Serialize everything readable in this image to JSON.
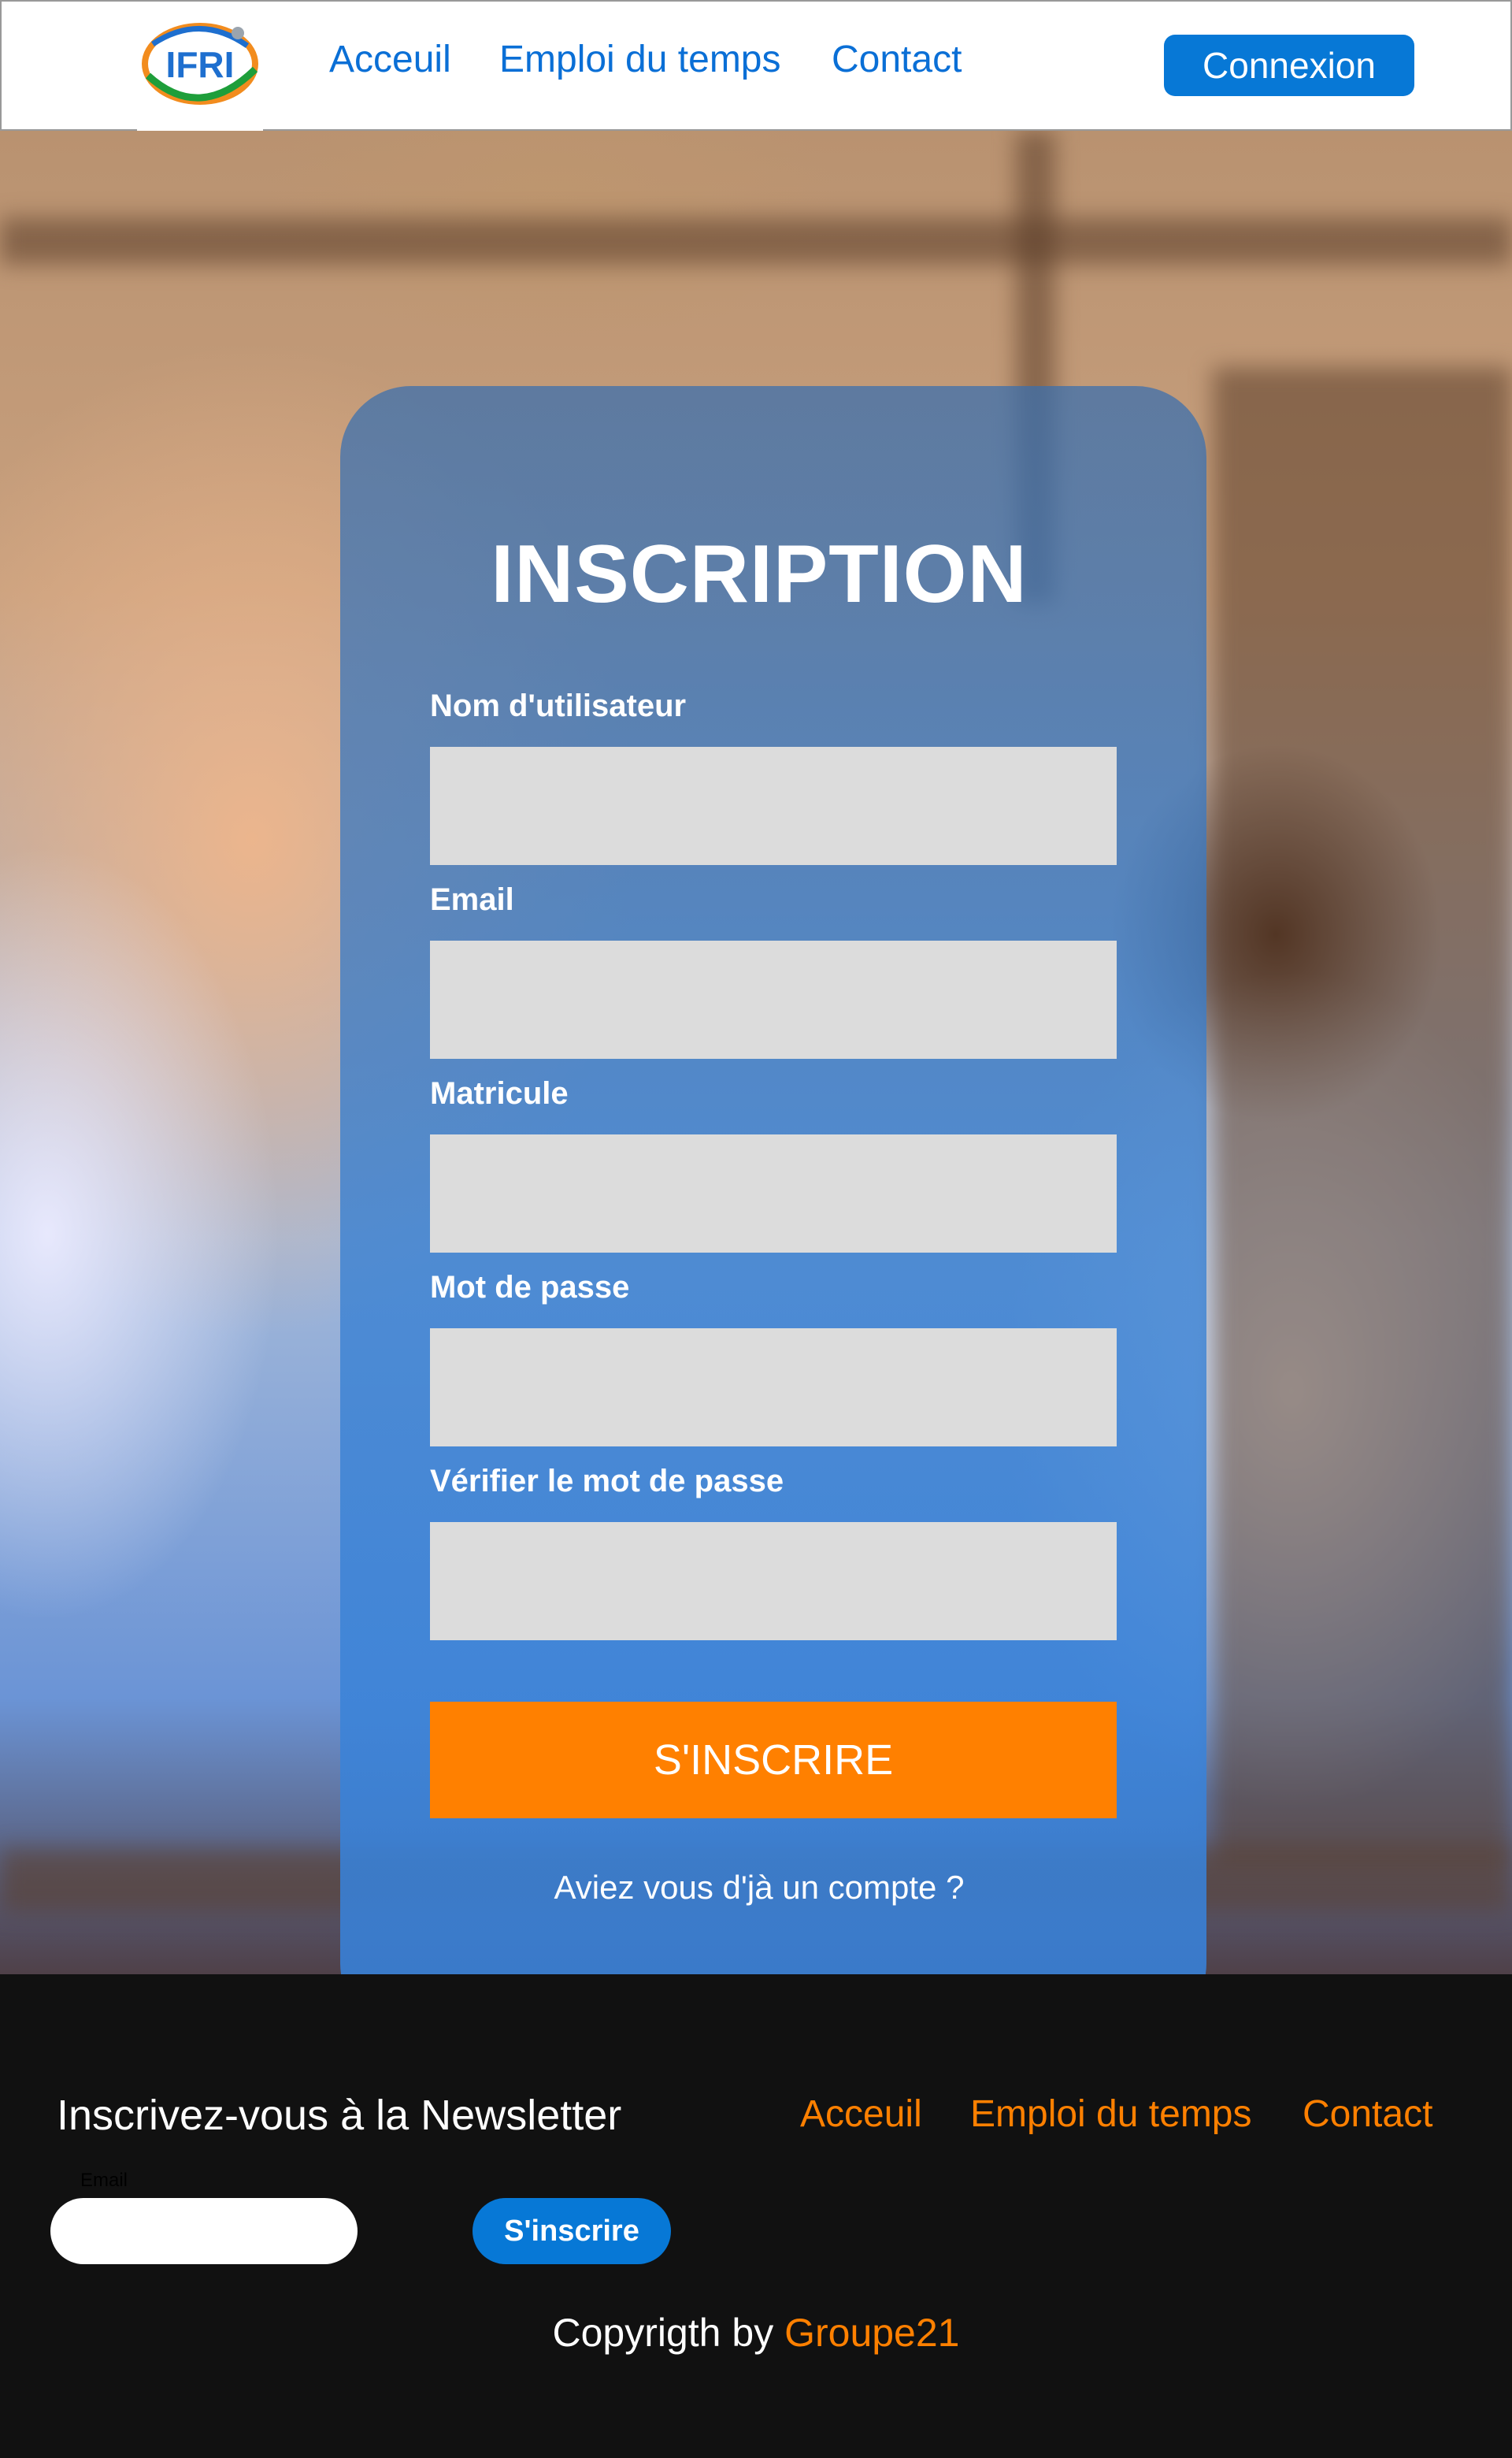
{
  "header": {
    "logo_text": "IFRI",
    "nav": [
      "Acceuil",
      "Emploi du temps",
      "Contact"
    ],
    "login_button": "Connexion"
  },
  "form": {
    "title": "INSCRIPTION",
    "fields": [
      {
        "label": "Nom d'utilisateur",
        "value": ""
      },
      {
        "label": "Email",
        "value": ""
      },
      {
        "label": "Matricule",
        "value": ""
      },
      {
        "label": "Mot de passe",
        "value": ""
      },
      {
        "label": "Vérifier le mot de passe",
        "value": ""
      }
    ],
    "submit_label": "S'INSCRIRE",
    "account_link": "Aviez vous d'jà un compte ?"
  },
  "footer": {
    "newsletter_title": "Inscrivez-vous à la Newsletter",
    "nav": [
      "Acceuil",
      "Emploi du temps",
      "Contact"
    ],
    "email_label": "Email",
    "email_value": "",
    "subscribe_label": "S'inscrire",
    "copyright_prefix": "Copyrigth by ",
    "copyright_brand": "Groupe21"
  },
  "colors": {
    "primary_blue": "#0778d6",
    "accent_orange": "#ff8000",
    "footer_bg": "#111111",
    "input_gray": "#dcdcdc"
  }
}
